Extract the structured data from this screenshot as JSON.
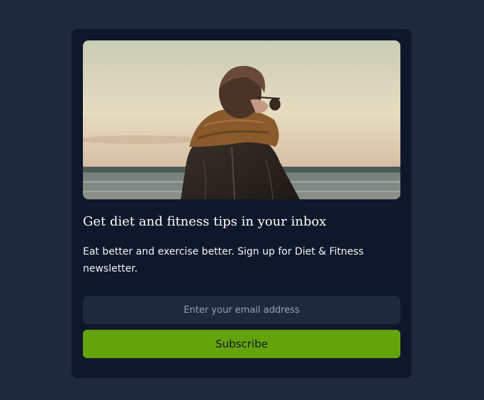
{
  "card": {
    "image_alt": "Person in leather jacket and scarf looking at the sea",
    "title": "Get diet and fitness tips in your inbox",
    "description": "Eat better and exercise better. Sign up for Diet & Fitness newsletter.",
    "email_placeholder": "Enter your email address",
    "email_value": "",
    "subscribe_label": "Subscribe"
  },
  "colors": {
    "page_background": "#1e293b",
    "card_background": "#0f172a",
    "input_background": "#1e293b",
    "accent": "#65a30d"
  }
}
